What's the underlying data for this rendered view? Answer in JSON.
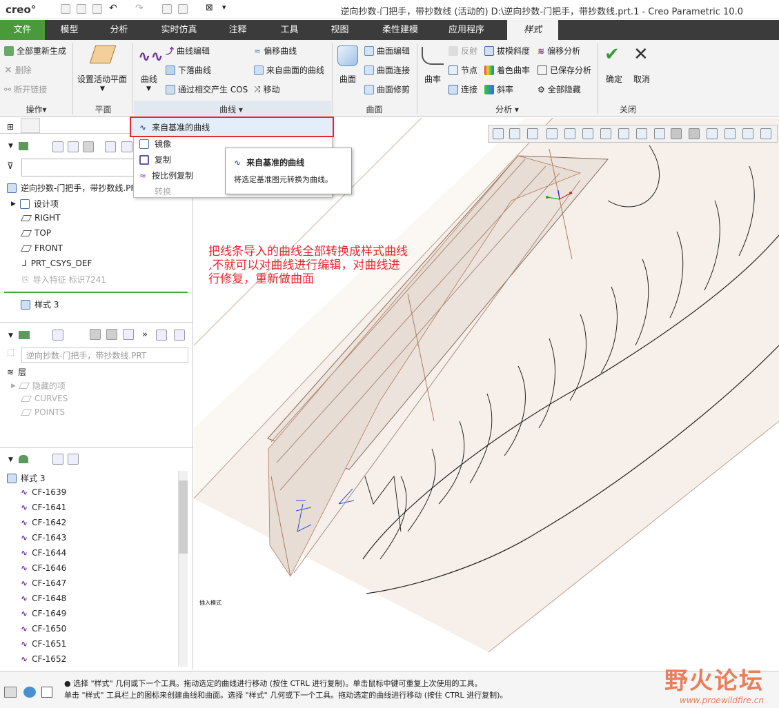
{
  "app": {
    "logo": "creo°",
    "title": "逆向抄数-门把手，带抄数线 (活动的) D:\\逆向抄数-门把手，带抄数线.prt.1 - Creo Parametric 10.0"
  },
  "tabs": [
    "文件",
    "模型",
    "分析",
    "实时仿真",
    "注释",
    "工具",
    "视图",
    "柔性建模",
    "应用程序",
    "样式"
  ],
  "ribbon": {
    "ops": {
      "regen": "全部重新生成",
      "delete": "删除",
      "break": "断开链接",
      "group": "操作▾"
    },
    "plane": {
      "set": "设置活动平面",
      "group": "平面"
    },
    "curve": {
      "curve": "曲线",
      "edit": "曲线编辑",
      "drop": "下落曲线",
      "intersect": "通过相交产生 COS",
      "offset": "偏移曲线",
      "fromsurf": "来自曲面的曲线",
      "move": "移动",
      "group": "曲线 ▾"
    },
    "surface": {
      "surface": "曲面",
      "edit": "曲面编辑",
      "connect": "曲面连接",
      "trim": "曲面修剪",
      "group": "曲面"
    },
    "analysis": {
      "curvature": "曲率",
      "reflect": "反射",
      "node": "节点",
      "connect": "连接",
      "draft": "拔模斜度",
      "color": "着色曲率",
      "slope": "斜率",
      "offset": "偏移分析",
      "saved": "已保存分析",
      "hideall": "全部隐藏",
      "group": "分析 ▾"
    },
    "close": {
      "ok": "确定",
      "cancel": "取消",
      "group": "关闭"
    }
  },
  "dropdown": {
    "items": [
      "来自基准的曲线",
      "镜像",
      "复制",
      "按比例复制",
      "转换"
    ]
  },
  "tooltip": {
    "title": "来自基准的曲线",
    "body": "将选定基准图元转换为曲线。"
  },
  "modeltree": {
    "root": "逆向抄数-门把手，带抄数线.PRT",
    "items": [
      "设计项",
      "RIGHT",
      "TOP",
      "FRONT",
      "PRT_CSYS_DEF",
      "导入特征 标识7241"
    ],
    "style": "样式 3"
  },
  "layers": {
    "selector": "逆向抄数-门把手，带抄数线.PRT",
    "title": "层",
    "items": [
      "隐藏的项",
      "CURVES",
      "POINTS"
    ]
  },
  "styletree": {
    "title": "样式 3",
    "items": [
      "CF-1639",
      "CF-1641",
      "CF-1642",
      "CF-1643",
      "CF-1644",
      "CF-1646",
      "CF-1647",
      "CF-1648",
      "CF-1649",
      "CF-1650",
      "CF-1651",
      "CF-1652"
    ]
  },
  "annotation": {
    "lines": [
      "把线条导入的曲线全部转换成样式曲线",
      ",不就可以对曲线进行编辑，对曲线进",
      "行修复，重新做曲面"
    ]
  },
  "viewlabel": "插入模式",
  "status": {
    "line1": "● 选择 \"样式\" 几何或下一个工具。拖动选定的曲线进行移动 (按住 CTRL 进行复制)。单击鼠标中键可重复上次使用的工具。",
    "line2": "单击 \"样式\" 工具栏上的图标来创建曲线和曲面。选择 \"样式\" 几何或下一个工具。拖动选定的曲线进行移动 (按住 CTRL 进行复制)。"
  },
  "watermark": {
    "main": "野火论坛",
    "url": "www.proewildfire.cn"
  },
  "colors": {
    "accent": "#4a9a3c",
    "highlight": "#e8242c",
    "curve": "#7030a0"
  }
}
